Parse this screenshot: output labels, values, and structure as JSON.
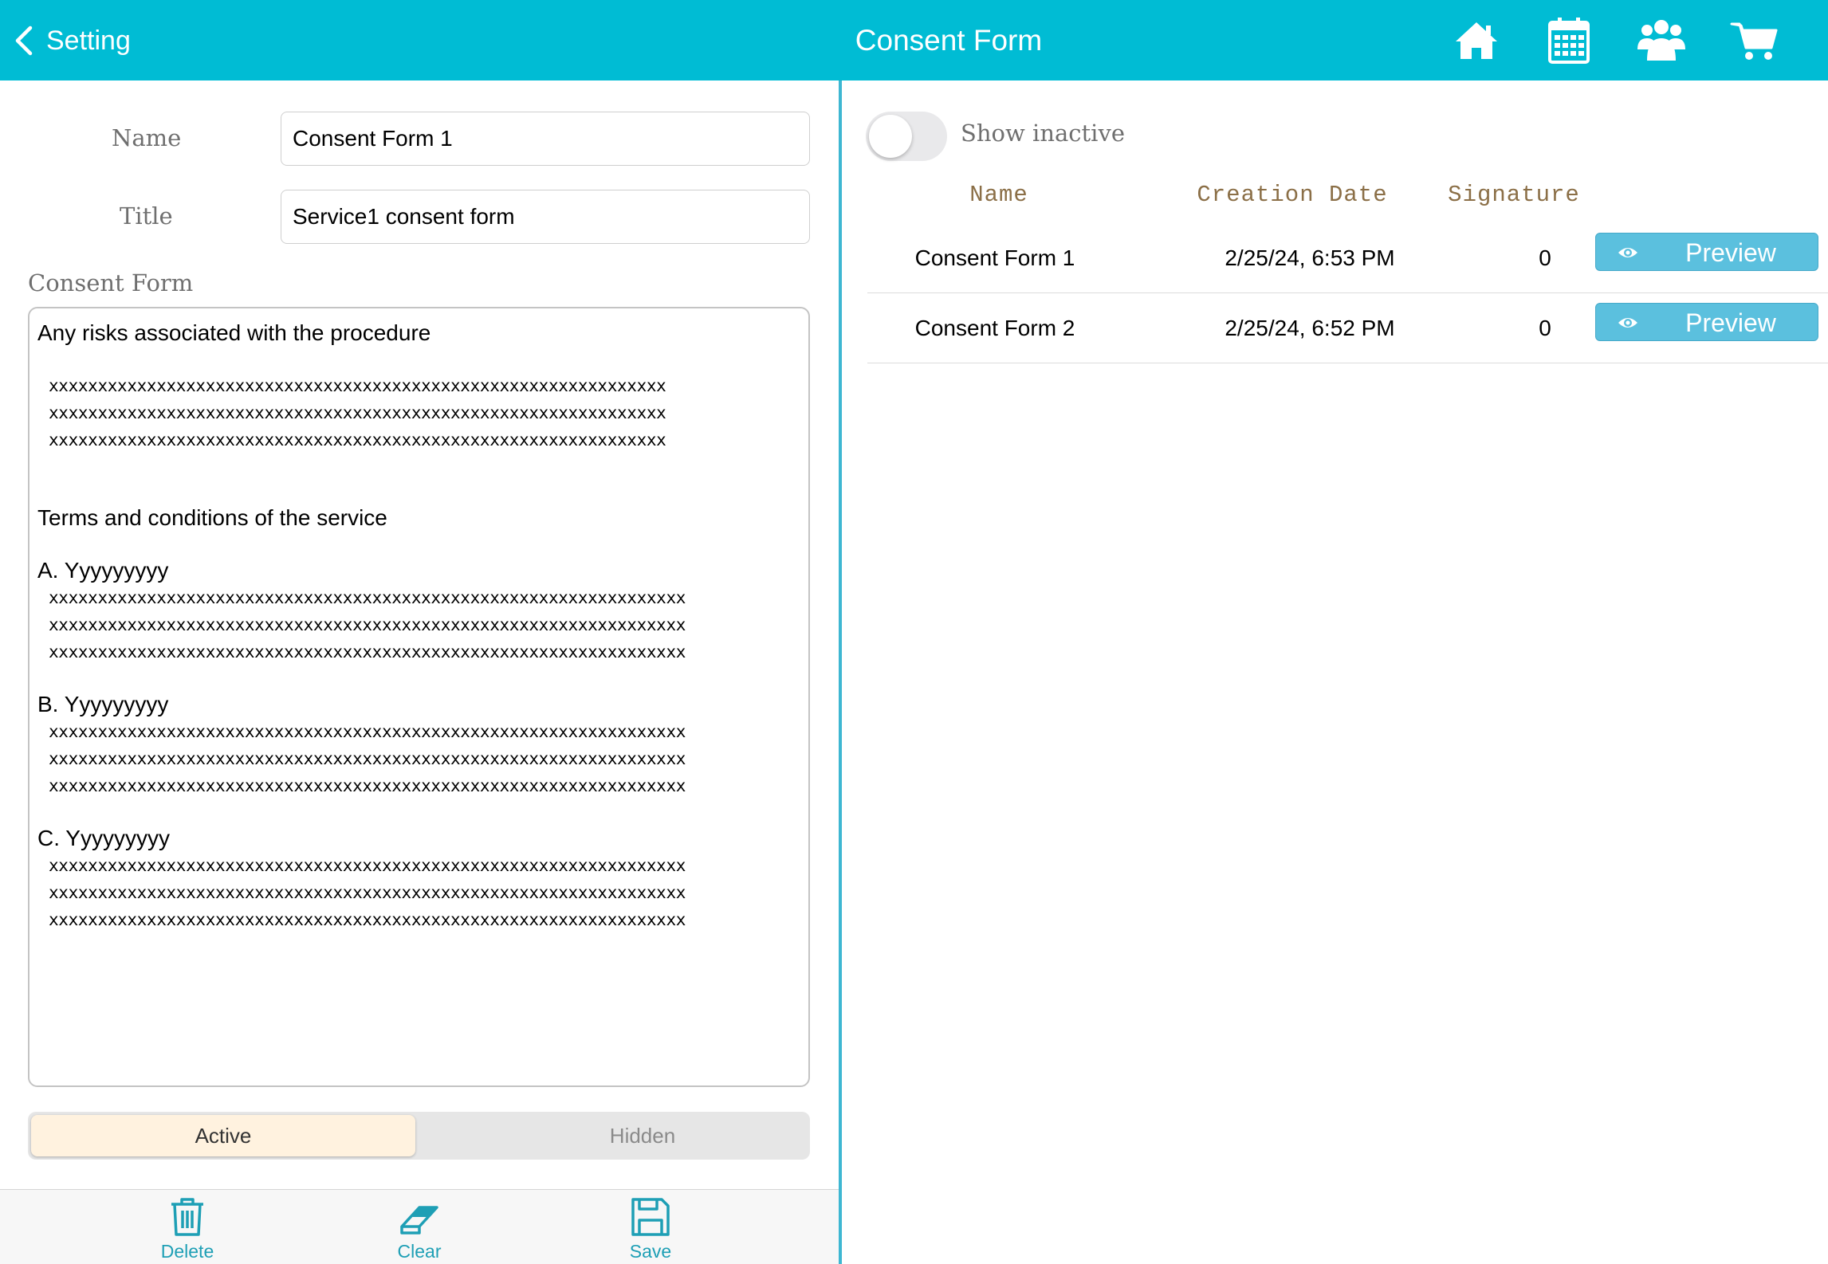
{
  "header": {
    "back_label": "Setting",
    "title": "Consent Form",
    "icons": [
      "home-icon",
      "calendar-icon",
      "people-icon",
      "cart-icon"
    ],
    "color": "#00BCD4"
  },
  "form": {
    "name_label": "Name",
    "name_value": "Consent Form 1",
    "title_label": "Title",
    "title_value": "Service1 consent form",
    "consent_label": "Consent Form",
    "consent_text": {
      "line1": "Any risks associated with the procedure",
      "x_short": "xxxxxxxxxxxxxxxxxxxxxxxxxxxxxxxxxxxxxxxxxxxxxxxxxxxxxxxxxxxxxxx",
      "terms": "Terms and conditions of the service",
      "a": "A. Yyyyyyyyy",
      "b": "B. Yyyyyyyyy",
      "c": "C. Yyyyyyyyy",
      "x_long": "xxxxxxxxxxxxxxxxxxxxxxxxxxxxxxxxxxxxxxxxxxxxxxxxxxxxxxxxxxxxxxxxx"
    },
    "segment": {
      "active": "Active",
      "hidden": "Hidden",
      "selected": "Active"
    }
  },
  "actions": {
    "delete": "Delete",
    "clear": "Clear",
    "save": "Save"
  },
  "list": {
    "show_inactive_label": "Show inactive",
    "show_inactive_on": false,
    "headers": {
      "name": "Name",
      "date": "Creation Date",
      "signature": "Signature"
    },
    "rows": [
      {
        "name": "Consent Form 1",
        "date": "2/25/24, 6:53 PM",
        "signature": "0",
        "button": "Preview"
      },
      {
        "name": "Consent Form 2",
        "date": "2/25/24, 6:52 PM",
        "signature": "0",
        "button": "Preview"
      }
    ]
  }
}
